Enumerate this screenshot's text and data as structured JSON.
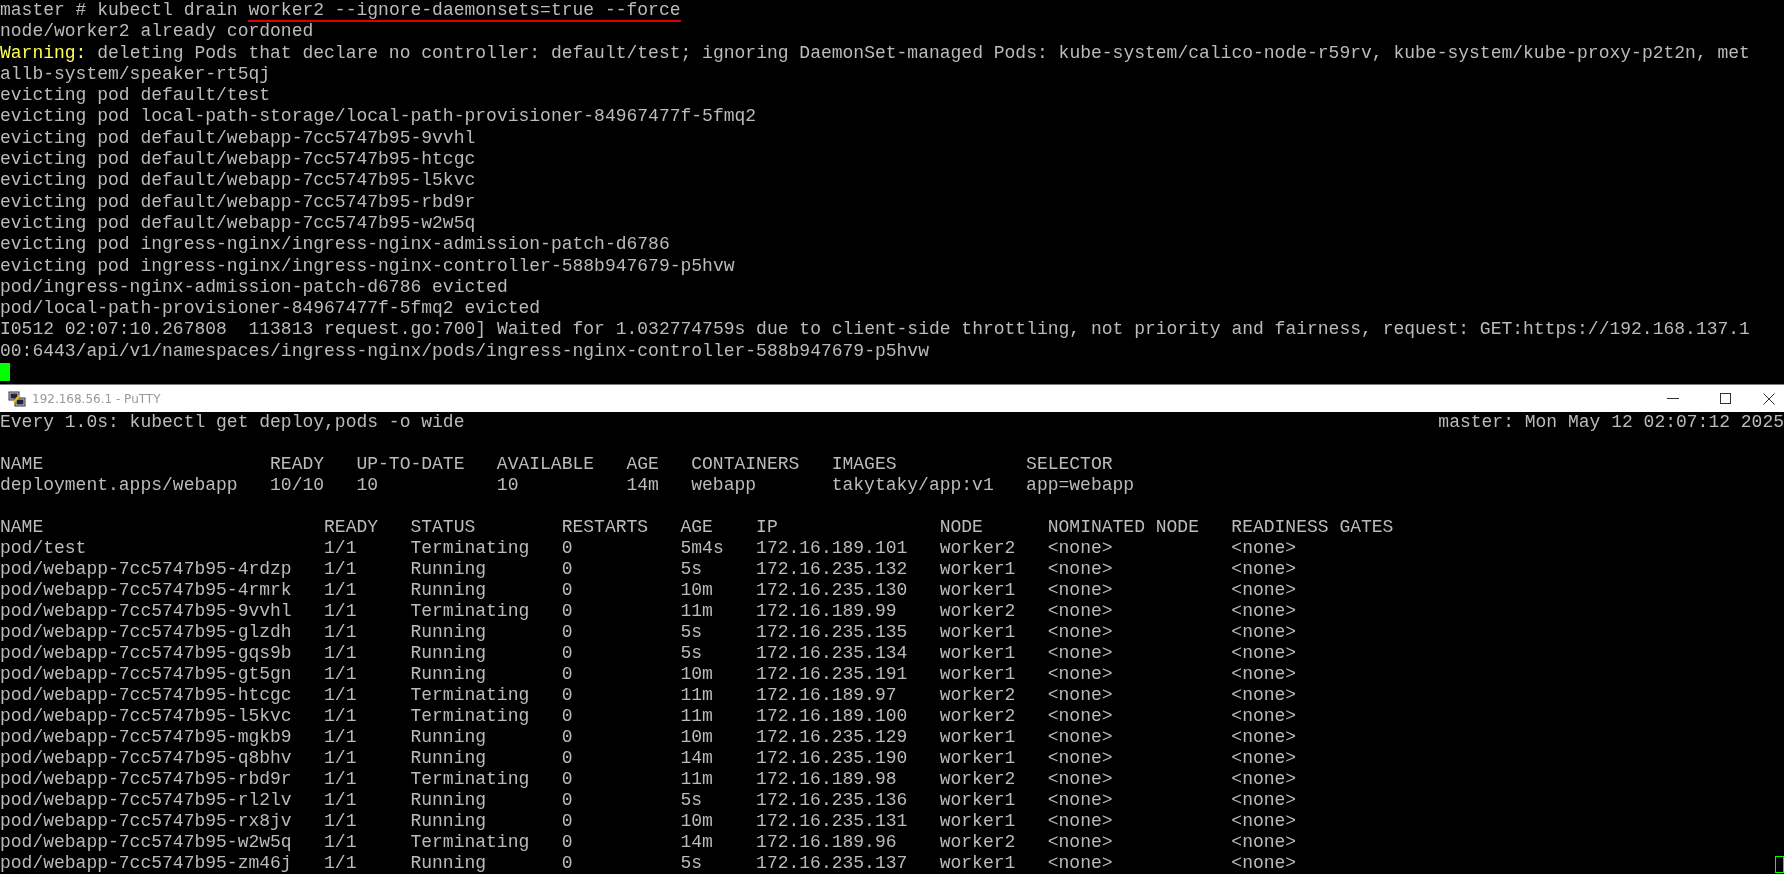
{
  "top_terminal": {
    "lines": [
      {
        "kind": "command",
        "text": "master # kubectl drain ",
        "marked": "worker2 --ignore-daemonsets=true --force"
      },
      {
        "kind": "text",
        "text": "node/worker2 already cordoned"
      },
      {
        "kind": "warning",
        "label": "Warning:",
        "text": " deleting Pods that declare no controller: default/test; ignoring DaemonSet-managed Pods: kube-system/calico-node-r59rv, kube-system/kube-proxy-p2t2n, met"
      },
      {
        "kind": "text",
        "text": "allb-system/speaker-rt5qj"
      },
      {
        "kind": "text",
        "text": "evicting pod default/test"
      },
      {
        "kind": "text",
        "text": "evicting pod local-path-storage/local-path-provisioner-84967477f-5fmq2"
      },
      {
        "kind": "text",
        "text": "evicting pod default/webapp-7cc5747b95-9vvhl"
      },
      {
        "kind": "text",
        "text": "evicting pod default/webapp-7cc5747b95-htcgc"
      },
      {
        "kind": "text",
        "text": "evicting pod default/webapp-7cc5747b95-l5kvc"
      },
      {
        "kind": "text",
        "text": "evicting pod default/webapp-7cc5747b95-rbd9r"
      },
      {
        "kind": "text",
        "text": "evicting pod default/webapp-7cc5747b95-w2w5q"
      },
      {
        "kind": "text",
        "text": "evicting pod ingress-nginx/ingress-nginx-admission-patch-d6786"
      },
      {
        "kind": "text",
        "text": "evicting pod ingress-nginx/ingress-nginx-controller-588b947679-p5hvw"
      },
      {
        "kind": "text",
        "text": "pod/ingress-nginx-admission-patch-d6786 evicted"
      },
      {
        "kind": "text",
        "text": "pod/local-path-provisioner-84967477f-5fmq2 evicted"
      },
      {
        "kind": "text",
        "text": "I0512 02:07:10.267808  113813 request.go:700] Waited for 1.032774759s due to client-side throttling, not priority and fairness, request: GET:https://192.168.137.1"
      },
      {
        "kind": "text",
        "text": "00:6443/api/v1/namespaces/ingress-nginx/pods/ingress-nginx-controller-588b947679-p5hvw"
      }
    ]
  },
  "window": {
    "title": "192.168.56.1 - PuTTY"
  },
  "bottom_terminal": {
    "header_left": "Every 1.0s: kubectl get deploy,pods -o wide",
    "header_right": "master: Mon May 12 02:07:12 2025",
    "deployments": {
      "columns": [
        "NAME",
        "READY",
        "UP-TO-DATE",
        "AVAILABLE",
        "AGE",
        "CONTAINERS",
        "IMAGES",
        "SELECTOR"
      ],
      "rows": [
        [
          "deployment.apps/webapp",
          "10/10",
          "10",
          "10",
          "14m",
          "webapp",
          "takytaky/app:v1",
          "app=webapp"
        ]
      ]
    },
    "pods": {
      "columns": [
        "NAME",
        "READY",
        "STATUS",
        "RESTARTS",
        "AGE",
        "IP",
        "NODE",
        "NOMINATED NODE",
        "READINESS GATES"
      ],
      "rows": [
        [
          "pod/test",
          "1/1",
          "Terminating",
          "0",
          "5m4s",
          "172.16.189.101",
          "worker2",
          "<none>",
          "<none>"
        ],
        [
          "pod/webapp-7cc5747b95-4rdzp",
          "1/1",
          "Running",
          "0",
          "5s",
          "172.16.235.132",
          "worker1",
          "<none>",
          "<none>"
        ],
        [
          "pod/webapp-7cc5747b95-4rmrk",
          "1/1",
          "Running",
          "0",
          "10m",
          "172.16.235.130",
          "worker1",
          "<none>",
          "<none>"
        ],
        [
          "pod/webapp-7cc5747b95-9vvhl",
          "1/1",
          "Terminating",
          "0",
          "11m",
          "172.16.189.99",
          "worker2",
          "<none>",
          "<none>"
        ],
        [
          "pod/webapp-7cc5747b95-glzdh",
          "1/1",
          "Running",
          "0",
          "5s",
          "172.16.235.135",
          "worker1",
          "<none>",
          "<none>"
        ],
        [
          "pod/webapp-7cc5747b95-gqs9b",
          "1/1",
          "Running",
          "0",
          "5s",
          "172.16.235.134",
          "worker1",
          "<none>",
          "<none>"
        ],
        [
          "pod/webapp-7cc5747b95-gt5gn",
          "1/1",
          "Running",
          "0",
          "10m",
          "172.16.235.191",
          "worker1",
          "<none>",
          "<none>"
        ],
        [
          "pod/webapp-7cc5747b95-htcgc",
          "1/1",
          "Terminating",
          "0",
          "11m",
          "172.16.189.97",
          "worker2",
          "<none>",
          "<none>"
        ],
        [
          "pod/webapp-7cc5747b95-l5kvc",
          "1/1",
          "Terminating",
          "0",
          "11m",
          "172.16.189.100",
          "worker2",
          "<none>",
          "<none>"
        ],
        [
          "pod/webapp-7cc5747b95-mgkb9",
          "1/1",
          "Running",
          "0",
          "10m",
          "172.16.235.129",
          "worker1",
          "<none>",
          "<none>"
        ],
        [
          "pod/webapp-7cc5747b95-q8bhv",
          "1/1",
          "Running",
          "0",
          "14m",
          "172.16.235.190",
          "worker1",
          "<none>",
          "<none>"
        ],
        [
          "pod/webapp-7cc5747b95-rbd9r",
          "1/1",
          "Terminating",
          "0",
          "11m",
          "172.16.189.98",
          "worker2",
          "<none>",
          "<none>"
        ],
        [
          "pod/webapp-7cc5747b95-rl2lv",
          "1/1",
          "Running",
          "0",
          "5s",
          "172.16.235.136",
          "worker1",
          "<none>",
          "<none>"
        ],
        [
          "pod/webapp-7cc5747b95-rx8jv",
          "1/1",
          "Running",
          "0",
          "10m",
          "172.16.235.131",
          "worker1",
          "<none>",
          "<none>"
        ],
        [
          "pod/webapp-7cc5747b95-w2w5q",
          "1/1",
          "Terminating",
          "0",
          "14m",
          "172.16.189.96",
          "worker2",
          "<none>",
          "<none>"
        ],
        [
          "pod/webapp-7cc5747b95-zm46j",
          "1/1",
          "Running",
          "0",
          "5s",
          "172.16.235.137",
          "worker1",
          "<none>",
          "<none>"
        ]
      ]
    }
  }
}
